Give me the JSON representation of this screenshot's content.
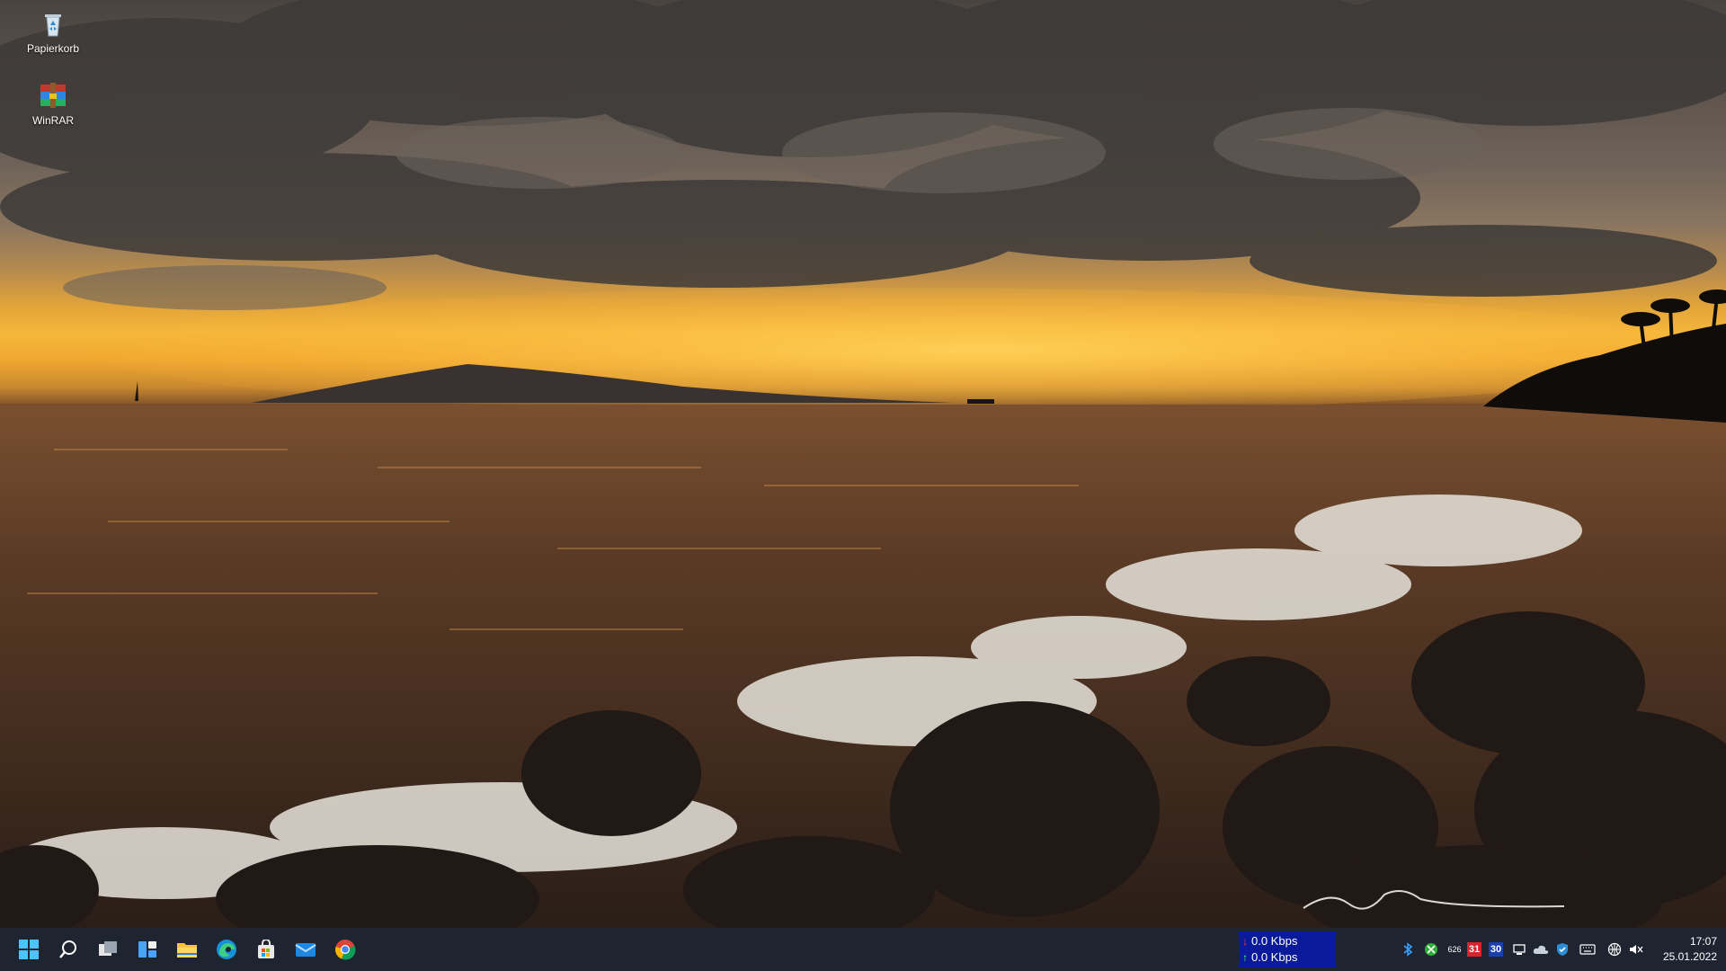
{
  "desktop": {
    "icons": [
      {
        "label": "Papierkorb",
        "icon": "recycle-bin-icon"
      },
      {
        "label": "WinRAR",
        "icon": "winrar-icon"
      }
    ]
  },
  "taskbar": {
    "pinned": [
      {
        "name": "start",
        "icon": "windows-start-icon"
      },
      {
        "name": "search",
        "icon": "search-icon"
      },
      {
        "name": "task-view",
        "icon": "task-view-icon"
      },
      {
        "name": "widgets",
        "icon": "widgets-icon"
      },
      {
        "name": "file-explorer",
        "icon": "folder-icon"
      },
      {
        "name": "edge",
        "icon": "edge-browser-icon"
      },
      {
        "name": "store",
        "icon": "store-icon"
      },
      {
        "name": "mail",
        "icon": "mail-icon"
      },
      {
        "name": "chrome",
        "icon": "chrome-icon"
      }
    ],
    "net_meter": {
      "download": "0.0 Kbps",
      "upload": "0.0 Kbps"
    },
    "tray": {
      "badge_626": "626",
      "badge_31": "31",
      "badge_30": "30"
    },
    "clock": {
      "time": "17:07",
      "date": "25.01.2022"
    }
  },
  "colors": {
    "taskbar_bg": "#1f2530",
    "net_meter_bg": "#0a1a9a",
    "accent_blue": "#0078d4"
  }
}
